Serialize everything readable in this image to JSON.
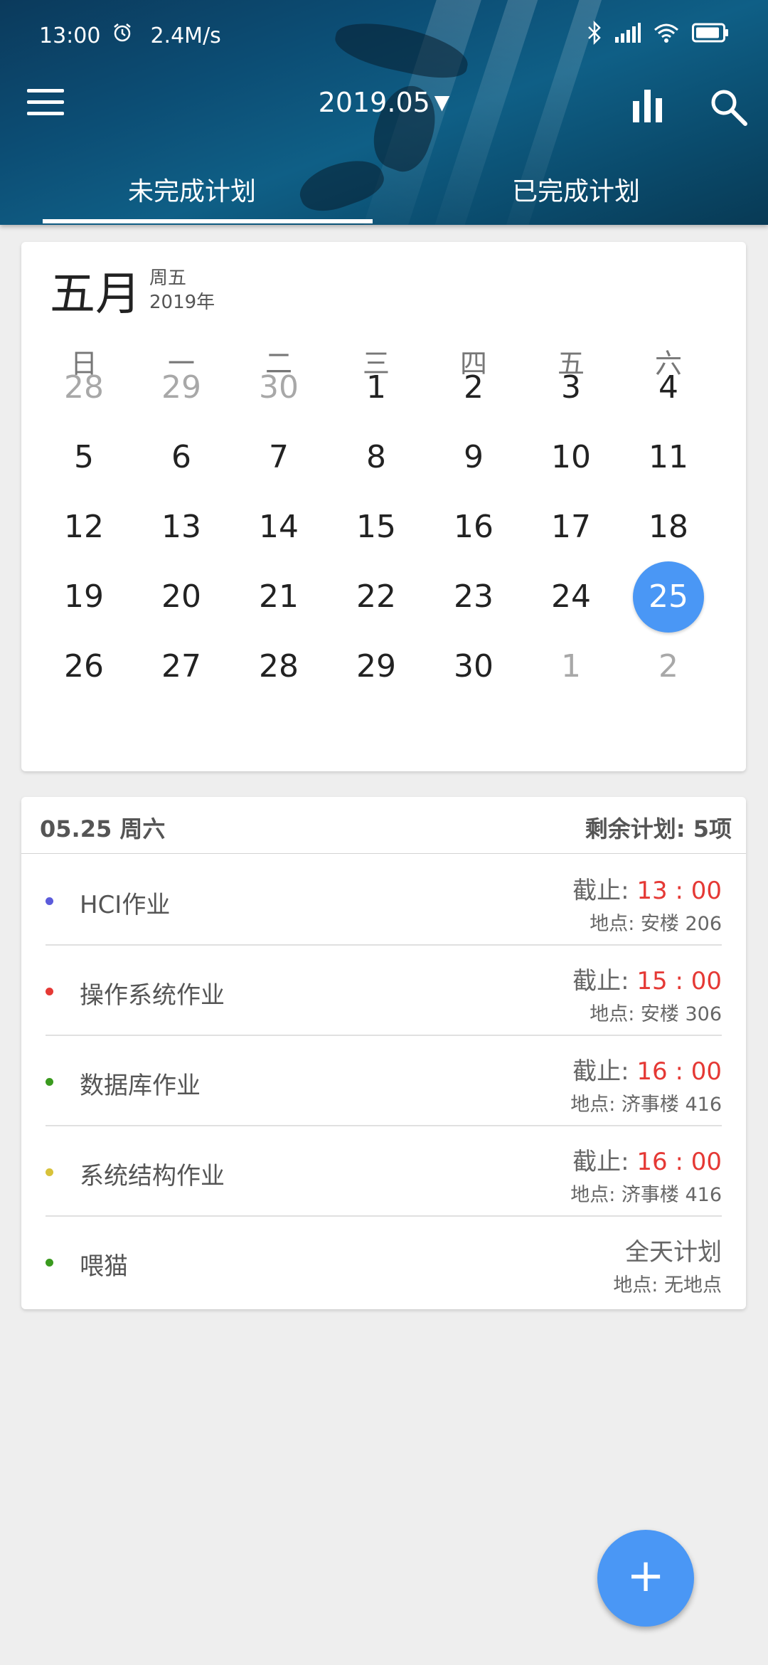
{
  "status_bar": {
    "time": "13:00",
    "speed": "2.4M/s",
    "icons": [
      "alarm-icon",
      "bluetooth-icon",
      "signal-icon",
      "wifi-icon",
      "battery-icon"
    ]
  },
  "toolbar": {
    "month_label": "2019.05",
    "caret": "▼"
  },
  "tabs": [
    {
      "label": "未完成计划"
    },
    {
      "label": "已完成计划"
    }
  ],
  "calendar": {
    "month": "五月",
    "weekday": "周五",
    "year": "2019年",
    "dow": [
      "日",
      "一",
      "二",
      "三",
      "四",
      "五",
      "六"
    ],
    "weeks": [
      [
        "28",
        "29",
        "30",
        "1",
        "2",
        "3",
        "4"
      ],
      [
        "5",
        "6",
        "7",
        "8",
        "9",
        "10",
        "11"
      ],
      [
        "12",
        "13",
        "14",
        "15",
        "16",
        "17",
        "18"
      ],
      [
        "19",
        "20",
        "21",
        "22",
        "23",
        "24",
        "25"
      ],
      [
        "26",
        "27",
        "28",
        "29",
        "30",
        "1",
        "2"
      ]
    ],
    "selected": "25"
  },
  "plans": {
    "date": "05.25 周六",
    "remaining": "剩余计划: 5项",
    "items": [
      {
        "name": "HCI作业",
        "deadline_label": "截止:",
        "time": "13 : 00",
        "location": "地点: 安楼 206",
        "color": "#5b5bdb"
      },
      {
        "name": "操作系统作业",
        "deadline_label": "截止:",
        "time": "15 : 00",
        "location": "地点: 安楼 306",
        "color": "#e53935"
      },
      {
        "name": "数据库作业",
        "deadline_label": "截止:",
        "time": "16 : 00",
        "location": "地点: 济事楼 416",
        "color": "#3a9a1e"
      },
      {
        "name": "系统结构作业",
        "deadline_label": "截止:",
        "time": "16 : 00",
        "location": "地点: 济事楼 416",
        "color": "#d8c23a"
      },
      {
        "name": "喂猫",
        "deadline_label": "全天计划",
        "time": "",
        "location": "地点: 无地点",
        "color": "#3a9a1e"
      }
    ]
  },
  "fab": {
    "label": "+"
  },
  "colors": {
    "accent": "#4a97f5",
    "deadline_time": "#e53935"
  }
}
